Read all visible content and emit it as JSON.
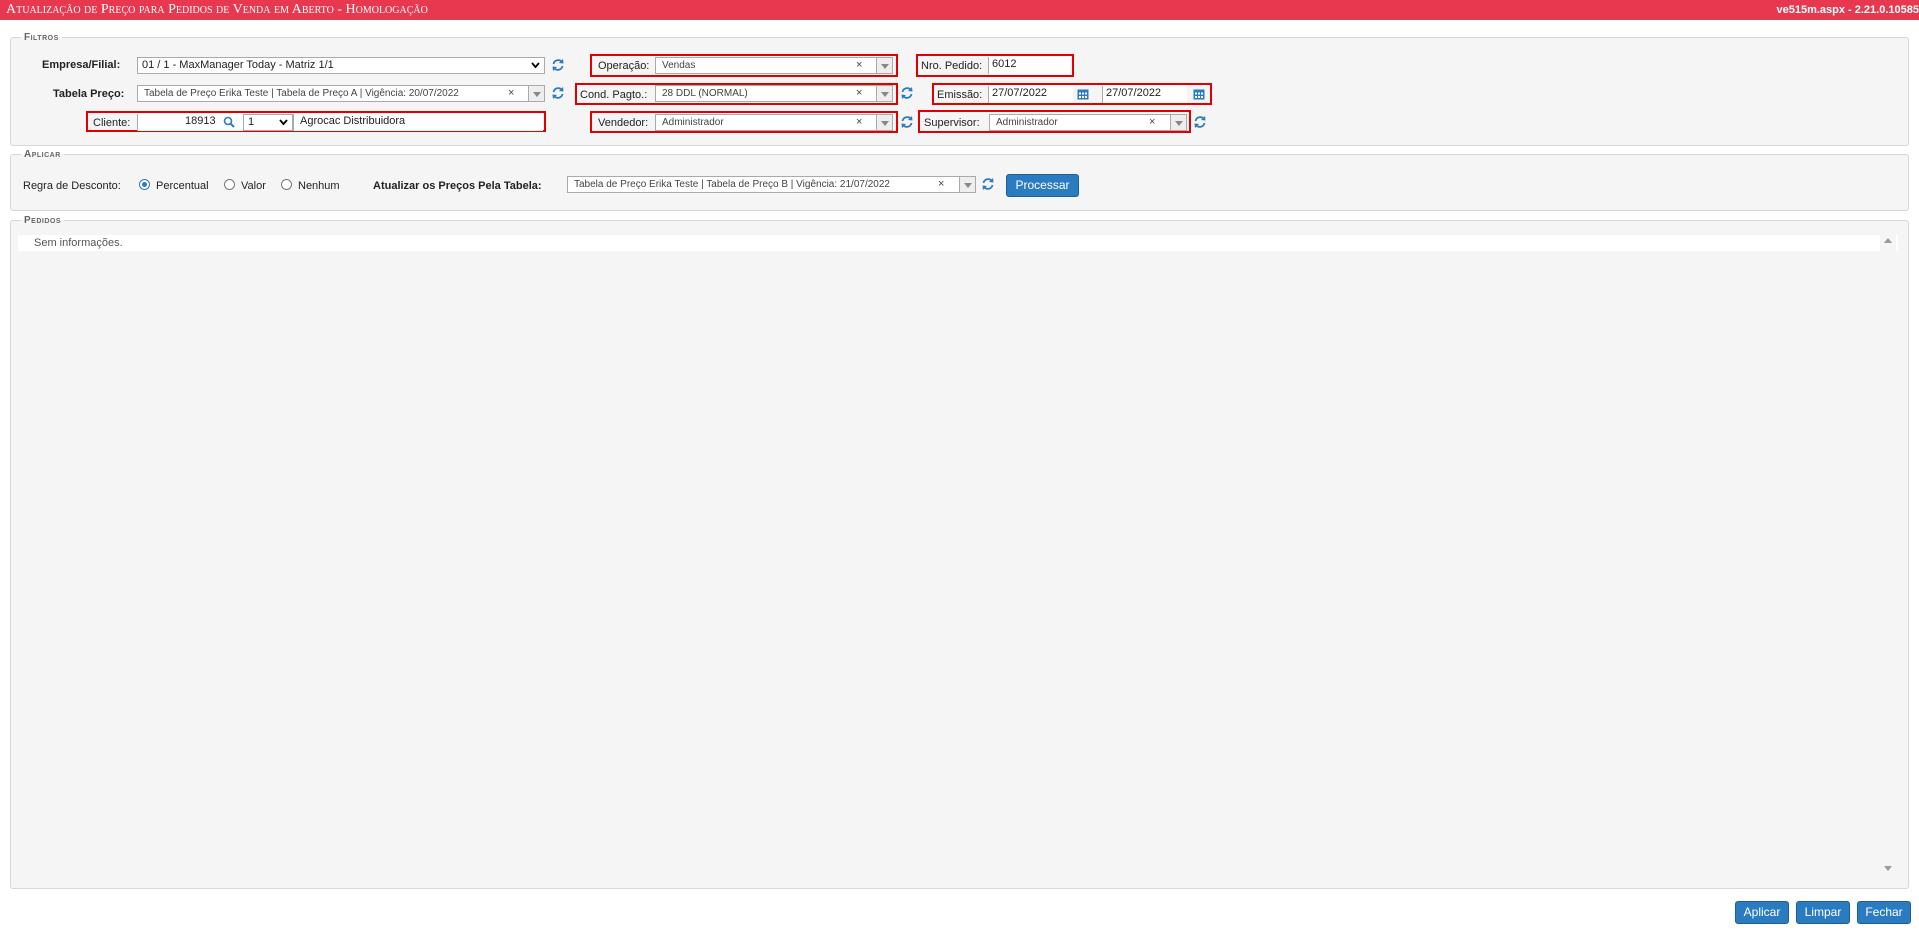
{
  "header": {
    "title": "Atualização de Preço para Pedidos de Venda em Aberto  - Homologação",
    "version": "ve515m.aspx - 2.21.0.10585"
  },
  "filtros": {
    "legend": "Filtros",
    "empresa": {
      "label": "Empresa/Filial:",
      "value": "01 / 1 - MaxManager Today - Matriz 1/1"
    },
    "tabela": {
      "label": "Tabela Preço:",
      "value": "Tabela de Preço Erika Teste | Tabela de Preço A | Vigência: 20/07/2022"
    },
    "cliente": {
      "label": "Cliente:",
      "code": "18913",
      "seq": "1",
      "name": "Agrocac Distribuidora"
    },
    "operacao": {
      "label": "Operação:",
      "value": "Vendas"
    },
    "cond": {
      "label": "Cond. Pagto.:",
      "value": "28 DDL (NORMAL)"
    },
    "vendedor": {
      "label": "Vendedor:",
      "value": "Administrador"
    },
    "pedido": {
      "label": "Nro. Pedido:",
      "value": "6012"
    },
    "emissao": {
      "label": "Emissão:",
      "from": "27/07/2022",
      "to": "27/07/2022"
    },
    "supervisor": {
      "label": "Supervisor:",
      "value": "Administrador"
    }
  },
  "aplicar": {
    "legend": "Aplicar",
    "regra_label": "Regra de Desconto:",
    "opt_percentual": "Percentual",
    "opt_valor": "Valor",
    "opt_nenhum": "Nenhum",
    "selected": "Percentual",
    "atualizar_label": "Atualizar os Preços Pela Tabela:",
    "tabela_value": "Tabela de Preço Erika Teste | Tabela de Preço B | Vigência: 21/07/2022",
    "processar": "Processar"
  },
  "pedidos": {
    "legend": "Pedidos",
    "empty": "Sem informações."
  },
  "footer": {
    "aplicar": "Aplicar",
    "limpar": "Limpar",
    "fechar": "Fechar"
  },
  "colors": {
    "title_bg": "#e8384f",
    "button": "#2b7bc0",
    "highlight": "#e00000"
  },
  "x_glyph": "×"
}
